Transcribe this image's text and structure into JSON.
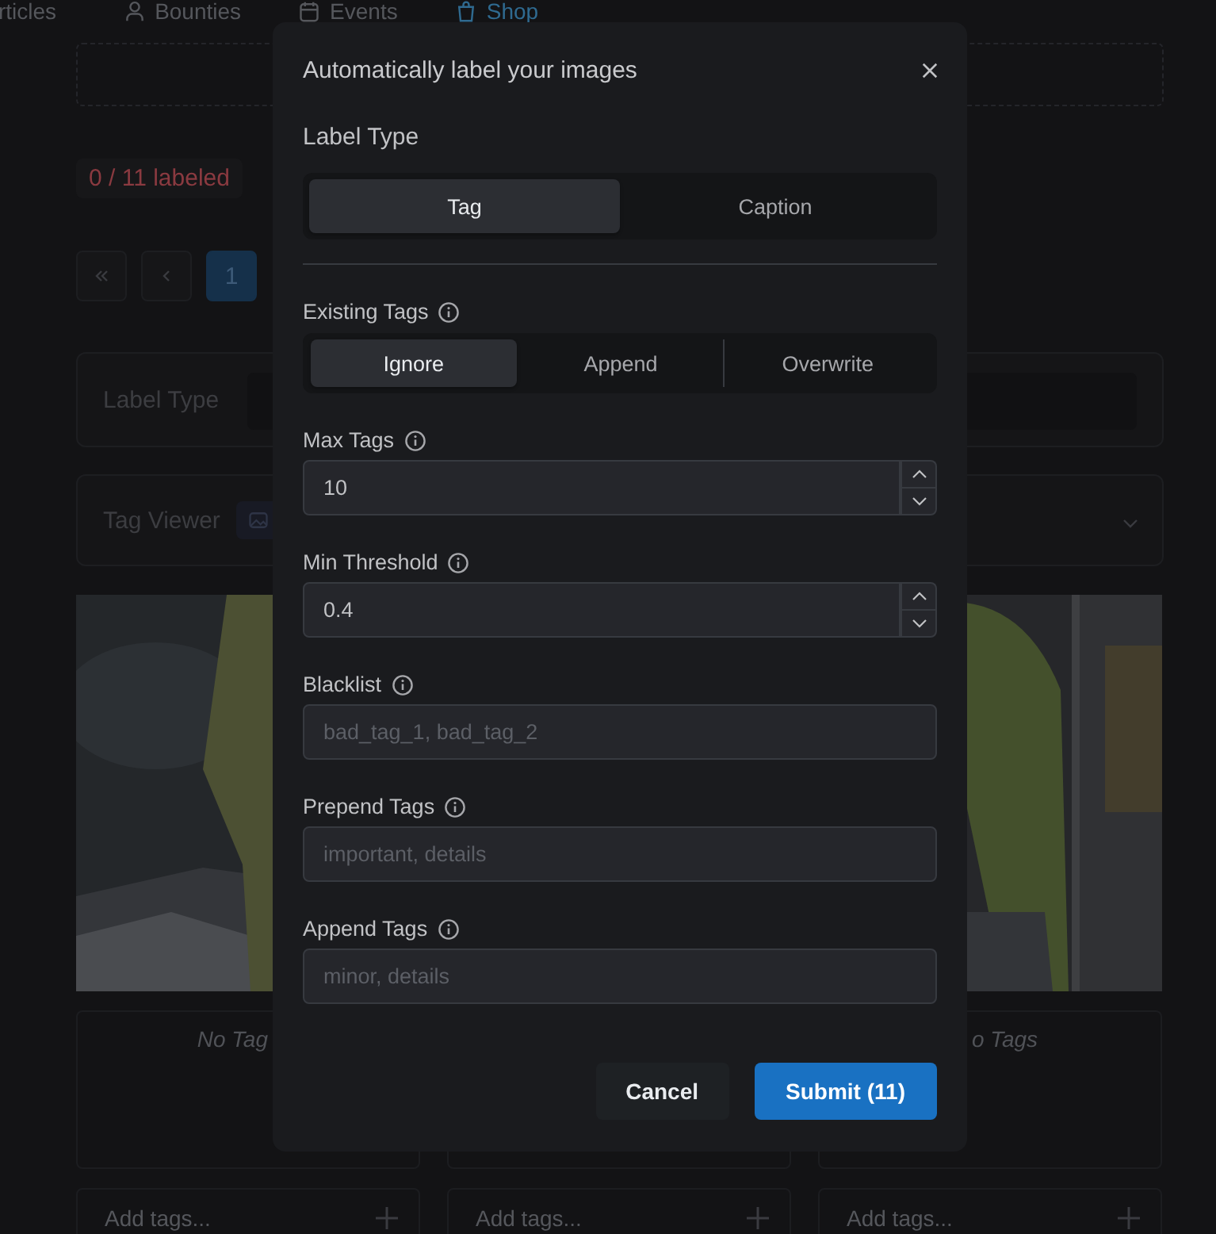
{
  "nav": [
    {
      "label": "rticles",
      "selected": false
    },
    {
      "label": "Bounties",
      "selected": false
    },
    {
      "label": "Events",
      "selected": false
    },
    {
      "label": "Shop",
      "selected": true
    }
  ],
  "background": {
    "labeled_count": "0 / 11 labeled",
    "pagination": [
      {
        "kind": "first",
        "selected": false
      },
      {
        "kind": "prev",
        "selected": false
      },
      {
        "kind": "page",
        "label": "1",
        "selected": true
      }
    ],
    "label_type_panel": {
      "label": "Label Type"
    },
    "tag_viewer_panel": {
      "label": "Tag Viewer"
    },
    "cards": [
      {
        "tags_text": "No Tag",
        "placeholder": "Add tags..."
      },
      {
        "placeholder": "Add tags..."
      },
      {
        "tags_text": "o Tags",
        "placeholder": "Add tags..."
      }
    ]
  },
  "modal": {
    "title": "Automatically label your images",
    "label_type": {
      "label": "Label Type",
      "options": [
        {
          "label": "Tag",
          "selected": true
        },
        {
          "label": "Caption",
          "selected": false
        }
      ]
    },
    "existing_tags": {
      "label": "Existing Tags",
      "options": [
        {
          "label": "Ignore",
          "selected": true
        },
        {
          "label": "Append",
          "selected": false
        },
        {
          "label": "Overwrite",
          "selected": false
        }
      ]
    },
    "fields": [
      {
        "kind": "number",
        "label": "Max Tags",
        "value": "10"
      },
      {
        "kind": "number",
        "label": "Min Threshold",
        "value": "0.4"
      },
      {
        "kind": "text",
        "label": "Blacklist",
        "placeholder": "bad_tag_1, bad_tag_2"
      },
      {
        "kind": "text",
        "label": "Prepend Tags",
        "placeholder": "important, details"
      },
      {
        "kind": "text",
        "label": "Append Tags",
        "placeholder": "minor, details"
      }
    ],
    "buttons": [
      {
        "kind": "secondary",
        "label": "Cancel"
      },
      {
        "kind": "primary",
        "label": "Submit (11)"
      }
    ]
  }
}
